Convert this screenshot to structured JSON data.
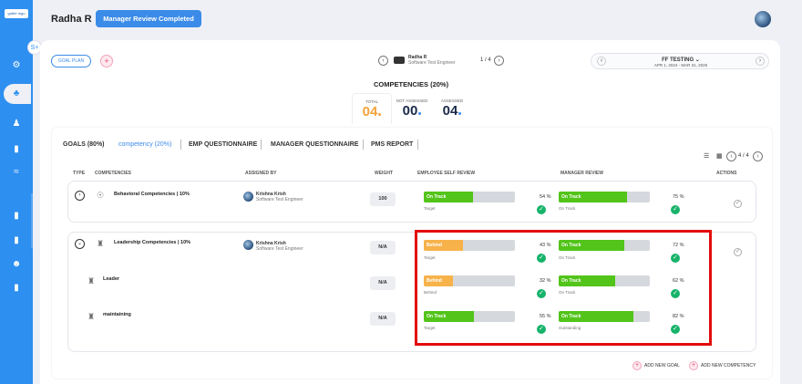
{
  "sidebar": {
    "logo_text": "gutter logo",
    "tab_label": "S+",
    "icons": [
      "gear-icon",
      "people-icon",
      "person-tree-icon",
      "doc-icon",
      "chart-icon",
      "doc-icon",
      "doc-icon",
      "users-icon",
      "doc-icon"
    ]
  },
  "header": {
    "user_name": "Radha R",
    "status": "Manager Review Completed"
  },
  "goal_plan": "GOAL PLAN",
  "employee": {
    "name": "Radha R",
    "role": "Software Test Engineer",
    "pager": "1 / 4"
  },
  "period": {
    "title": "FF TESTING",
    "range": "APR 1, 2024 - MAR 31, 2025"
  },
  "competencies_summary": {
    "title": "COMPETENCIES (20%)",
    "total_label": "TOTAL",
    "total": "04",
    "not_assessed_label": "NOT ASSESSED",
    "not_assessed": "00",
    "assessed_label": "ASSESSED",
    "assessed": "04"
  },
  "tabs": [
    "GOALS (80%)",
    "competency (20%)",
    "EMP QUESTIONNAIRE",
    "MANAGER QUESTIONNAIRE",
    "PMS REPORT"
  ],
  "table_pager": "4 / 4",
  "columns": {
    "type": "TYPE",
    "competencies": "COMPETENCIES",
    "assigned_by": "ASSIGNED BY",
    "weight": "WEIGHT",
    "self_review": "EMPLOYEE SELF REVIEW",
    "manager_review": "MANAGER REVIEW",
    "actions": "ACTIONS"
  },
  "rows": [
    {
      "title": "Behavioral Competencies | 10%",
      "assignee_name": "Krishna Krish",
      "assignee_role": "Software Test Engineer",
      "weight": "100",
      "self": {
        "status": "On Track",
        "fill": 0.54,
        "pct": "54 %",
        "sub": "Target",
        "color": "#52c41a"
      },
      "mgr": {
        "status": "On Track",
        "fill": 0.75,
        "pct": "75 %",
        "sub": "On Track",
        "color": "#52c41a"
      }
    },
    {
      "title": "Leadership Competencies | 10%",
      "assignee_name": "Krishna Krish",
      "assignee_role": "Software Test Engineer",
      "weight": "N/A",
      "self": {
        "status": "Behind",
        "fill": 0.43,
        "pct": "43 %",
        "sub": "Target",
        "color": "#f7b24a"
      },
      "mgr": {
        "status": "On Track",
        "fill": 0.72,
        "pct": "72 %",
        "sub": "On Track",
        "color": "#52c41a"
      }
    },
    {
      "title": "Leader",
      "weight": "N/A",
      "self": {
        "status": "Behind",
        "fill": 0.32,
        "pct": "32 %",
        "sub": "Behind",
        "color": "#f7b24a"
      },
      "mgr": {
        "status": "On Track",
        "fill": 0.62,
        "pct": "62 %",
        "sub": "On Track",
        "color": "#52c41a"
      }
    },
    {
      "title": "maintaining",
      "weight": "N/A",
      "self": {
        "status": "On Track",
        "fill": 0.55,
        "pct": "55 %",
        "sub": "Target",
        "color": "#52c41a"
      },
      "mgr": {
        "status": "On Track",
        "fill": 0.82,
        "pct": "82 %",
        "sub": "Outstanding",
        "color": "#52c41a"
      }
    }
  ],
  "footer": {
    "add_goal": "ADD NEW GOAL",
    "add_competency": "ADD NEW COMPETENCY"
  }
}
